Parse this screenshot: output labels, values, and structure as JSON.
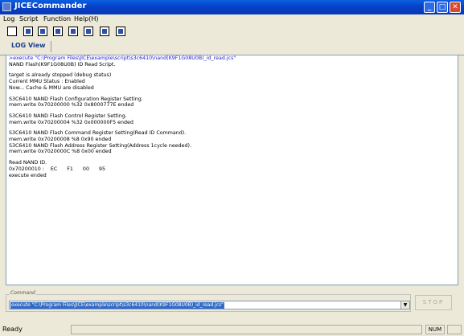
{
  "window": {
    "title": "JICECommander"
  },
  "menu": [
    "Log",
    "Script",
    "Function",
    "Help(H)"
  ],
  "toolbar": {
    "icons": [
      "new",
      "save",
      "script",
      "function",
      "disk",
      "register",
      "config",
      "window"
    ]
  },
  "tab": {
    "label": "LOG View"
  },
  "log": {
    "lines": [
      {
        "text": ">execute \"C:\\Program Files\\JICE\\example\\script\\s3c6410\\nand(K9F1G08U0B)_id_read.jcs\"",
        "color": "blue"
      },
      {
        "text": "NAND Flash(K9F1G08U0B) ID Read Script."
      },
      {
        "text": ""
      },
      {
        "text": "target is already stopped (debug status)"
      },
      {
        "text": "Current MMU Status : Enabled"
      },
      {
        "text": "Now... Cache & MMU are disabled"
      },
      {
        "text": ""
      },
      {
        "text": "S3C6410 NAND Flash Configuration Register Setting."
      },
      {
        "text": "mem.write 0x70200000 %32 0x8000777E ended"
      },
      {
        "text": ""
      },
      {
        "text": "S3C6410 NAND Flash Control Register Setting."
      },
      {
        "text": "mem.write 0x70200004 %32 0x000000F5 ended"
      },
      {
        "text": ""
      },
      {
        "text": "S3C6410 NAND Flash Command Register Setting(Read ID Command)."
      },
      {
        "text": "mem.write 0x70200008 %8 0x90 ended"
      },
      {
        "text": "S3C6410 NAND Flash Address Register Setting(Address 1cycle needed)."
      },
      {
        "text": "mem.write 0x7020000C %8 0x00 ended"
      },
      {
        "text": ""
      },
      {
        "text": "Read NAND ID."
      },
      {
        "text": "0x70200010 :    EC      F1      00      95"
      },
      {
        "text": "execute ended"
      }
    ]
  },
  "command": {
    "label": "Command",
    "value": "execute \"C:\\Program Files\\JICE\\example\\script\\s3c6410\\nand(K9F1G08U0B)_id_read.jcs\""
  },
  "stop_button": {
    "label": "STOP"
  },
  "statusbar": {
    "status": "Ready",
    "num": "NUM"
  }
}
